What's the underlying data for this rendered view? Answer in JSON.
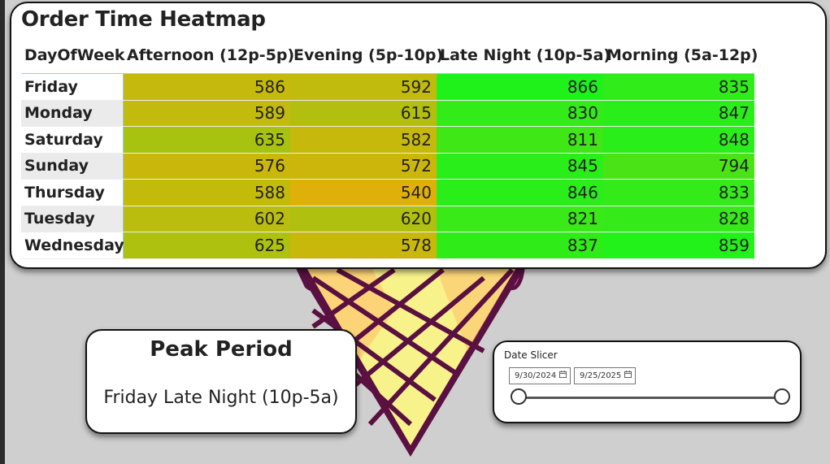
{
  "heatmap": {
    "title": "Order Time Heatmap",
    "headers": [
      "DayOfWeek",
      "Afternoon (12p-5p)",
      "Evening (5p-10p)",
      "Late Night (10p-5a)",
      "Morning (5a-12p)"
    ],
    "rows": [
      {
        "day": "Friday",
        "values": [
          586,
          592,
          866,
          835
        ]
      },
      {
        "day": "Monday",
        "values": [
          589,
          615,
          830,
          847
        ]
      },
      {
        "day": "Saturday",
        "values": [
          635,
          582,
          811,
          848
        ]
      },
      {
        "day": "Sunday",
        "values": [
          576,
          572,
          845,
          794
        ]
      },
      {
        "day": "Thursday",
        "values": [
          588,
          540,
          846,
          833
        ]
      },
      {
        "day": "Tuesday",
        "values": [
          602,
          620,
          821,
          828
        ]
      },
      {
        "day": "Wednesday",
        "values": [
          625,
          578,
          837,
          859
        ]
      }
    ],
    "colors": {
      "low": "#dfb00a",
      "high": "#1ef21a"
    }
  },
  "peak": {
    "title": "Peak Period",
    "value": "Friday Late Night (10p-5a)"
  },
  "date_slicer": {
    "label": "Date Slicer",
    "start": "9/30/2024",
    "end": "9/25/2025"
  }
}
